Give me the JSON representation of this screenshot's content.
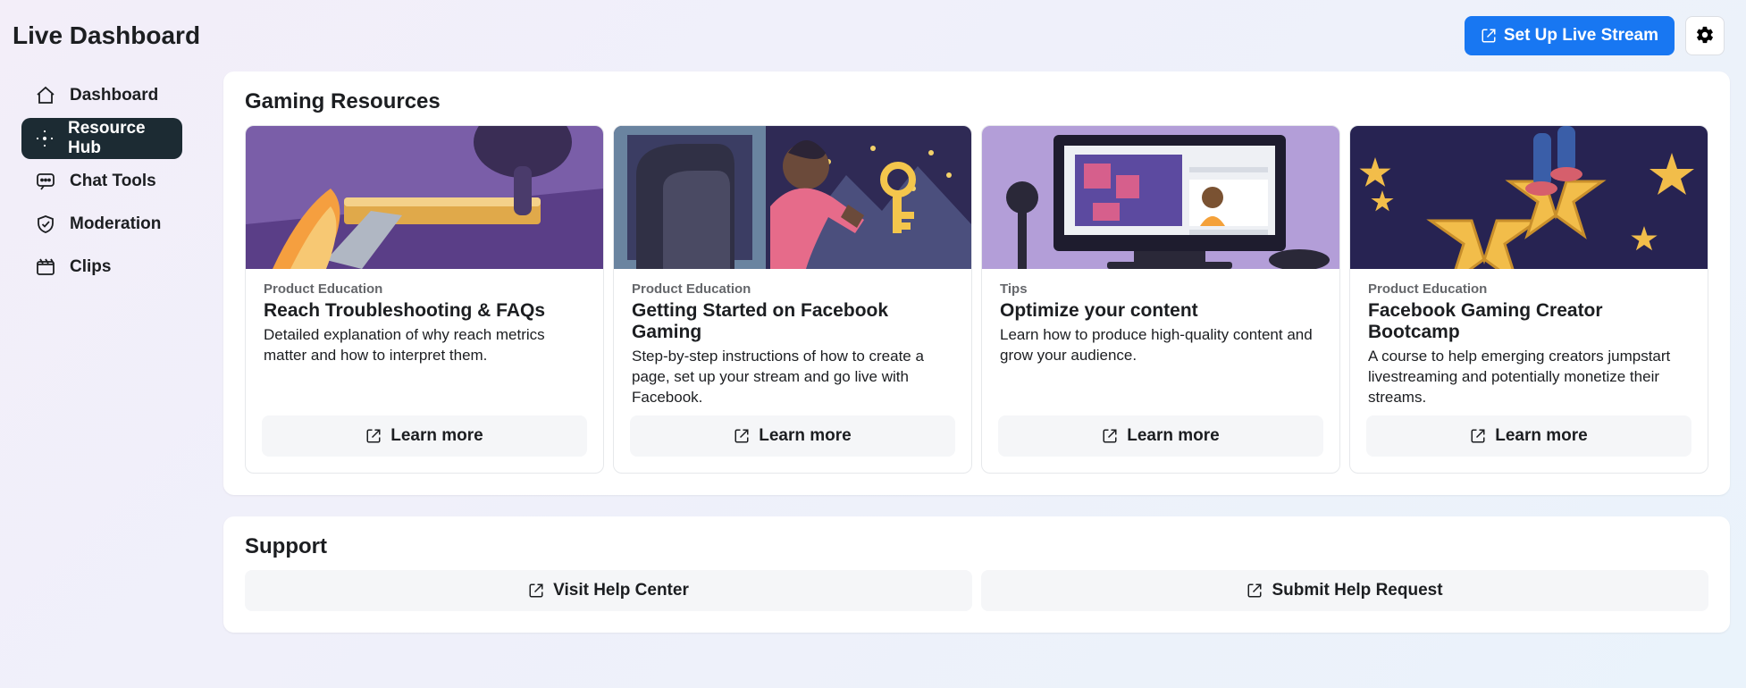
{
  "header": {
    "title": "Live Dashboard",
    "primary_button": "Set Up Live Stream"
  },
  "sidebar": {
    "items": [
      {
        "label": "Dashboard",
        "icon": "home-icon",
        "active": false
      },
      {
        "label": "Resource Hub",
        "icon": "resource-icon",
        "active": true
      },
      {
        "label": "Chat Tools",
        "icon": "chat-icon",
        "active": false
      },
      {
        "label": "Moderation",
        "icon": "shield-icon",
        "active": false
      },
      {
        "label": "Clips",
        "icon": "clip-icon",
        "active": false
      }
    ]
  },
  "resources": {
    "section_title": "Gaming Resources",
    "learn_more_label": "Learn more",
    "cards": [
      {
        "tag": "Product Education",
        "title": "Reach Troubleshooting & FAQs",
        "desc": "Detailed explanation of why reach metrics matter and how to interpret them."
      },
      {
        "tag": "Product Education",
        "title": "Getting Started on Facebook Gaming",
        "desc": "Step-by-step instructions of how to create a page, set up your stream and go live with Facebook."
      },
      {
        "tag": "Tips",
        "title": "Optimize your content",
        "desc": "Learn how to produce high-quality content and grow your audience."
      },
      {
        "tag": "Product Education",
        "title": "Facebook Gaming Creator Bootcamp",
        "desc": "A course to help emerging creators jumpstart livestreaming and potentially monetize their streams."
      }
    ]
  },
  "support": {
    "section_title": "Support",
    "help_center_label": "Visit Help Center",
    "help_request_label": "Submit Help Request"
  },
  "colors": {
    "primary": "#1877f2",
    "sidebar_active": "#1c2b33"
  }
}
